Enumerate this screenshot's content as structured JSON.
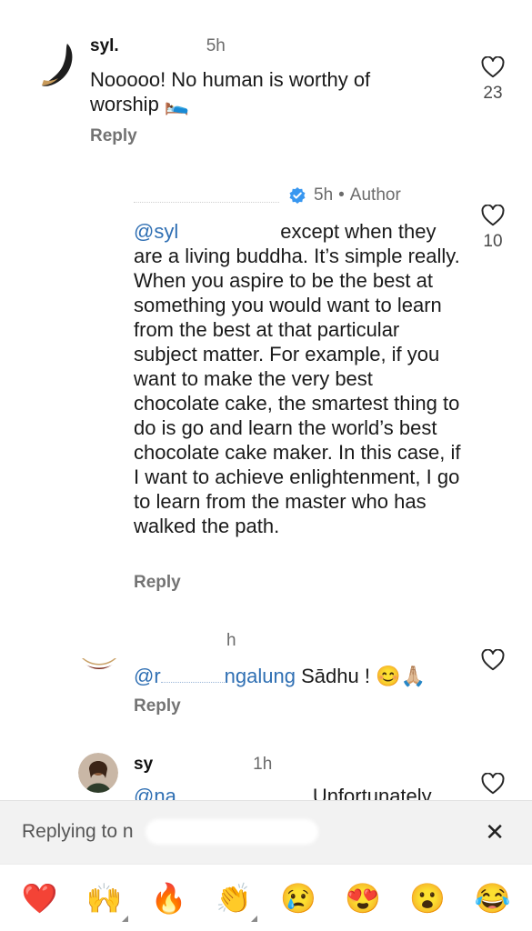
{
  "comments": [
    {
      "username": "syl.",
      "time": "5h",
      "text": "Nooooo! No human is worthy of worship 🛌",
      "reply": "Reply",
      "likes": "23"
    },
    {
      "username": "",
      "time": "5h",
      "author_label": "Author",
      "separator": "•",
      "mention": "@syl",
      "text_first": "except when they",
      "text_rest": "are a living buddha. It’s simple really. When you aspire to be the best at something you would want to learn from the best at that particular subject matter. For example, if you want to make the very best chocolate cake, the smartest thing to do is go and learn the world’s best chocolate cake maker.  In this case, if I want to achieve enlightenment, I go to learn from the master who has walked the path.",
      "reply": "Reply",
      "likes": "10"
    },
    {
      "username": "",
      "time": "h",
      "mention": "@r",
      "mention_tail": "ngalung",
      "text": "Sādhu ! 😊🙏🏼",
      "reply": "Reply"
    },
    {
      "username": "sy",
      "time": "1h",
      "mention": "@na",
      "text": "Unfortunately"
    }
  ],
  "reply_bar": {
    "label": "Replying to n",
    "close": "✕"
  },
  "reactions": [
    "❤️",
    "🙌",
    "🔥",
    "👏",
    "😢",
    "😍",
    "😮",
    "😂"
  ],
  "colors": {
    "mention": "#2f6fb3",
    "verified": "#3897f0"
  }
}
